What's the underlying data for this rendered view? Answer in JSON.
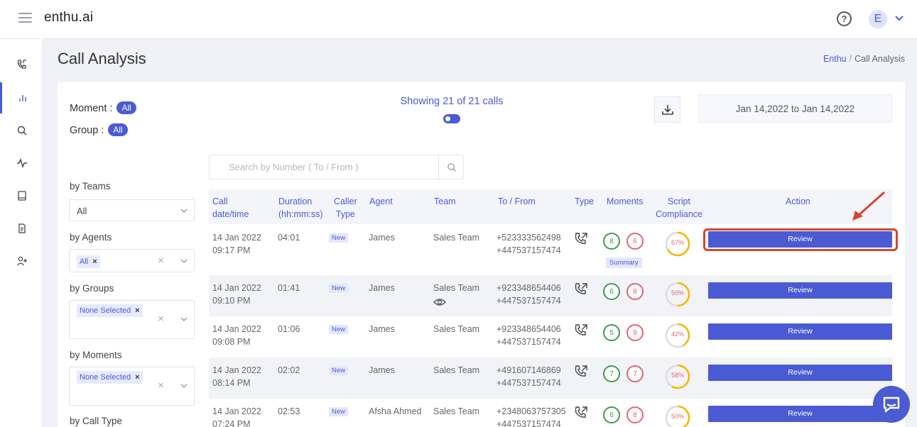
{
  "app": {
    "brand": "enthu.ai",
    "avatar_letter": "E"
  },
  "page": {
    "title": "Call Analysis"
  },
  "breadcrumb": {
    "root": "Enthu",
    "separator": "/",
    "current": "Call Analysis"
  },
  "filters_top": {
    "moment_label": "Moment :",
    "moment_value": "All",
    "group_label": "Group :",
    "group_value": "All"
  },
  "summary": {
    "showing": "Showing 21 of 21 calls"
  },
  "date_range": "Jan 14,2022 to Jan 14,2022",
  "side_filters": {
    "teams": {
      "label": "by Teams",
      "value": "All"
    },
    "agents": {
      "label": "by Agents",
      "chip": "All"
    },
    "groups": {
      "label": "by Groups",
      "chip": "None Selected"
    },
    "moments": {
      "label": "by Moments",
      "chip": "None Selected"
    },
    "call_type": {
      "label": "by Call Type"
    }
  },
  "search": {
    "placeholder": "Search by Number ( To / From )"
  },
  "table": {
    "headers": {
      "call_datetime": [
        "Call",
        "date/time"
      ],
      "duration": [
        "Duration",
        "(hh:mm:ss)"
      ],
      "caller_type": [
        "Caller",
        "Type"
      ],
      "agent": "Agent",
      "team": "Team",
      "to_from": "To / From",
      "type": "Type",
      "moments": "Moments",
      "script": [
        "Script",
        "Compliance"
      ],
      "action": "Action"
    },
    "rows": [
      {
        "date": "14 Jan 2022",
        "time": "09:17 PM",
        "duration": "04:01",
        "caller_type": "New",
        "agent": "James",
        "team": "Sales Team",
        "to": "+523333562498",
        "from": "+447537157474",
        "moments_pos": "8",
        "moments_neg": "6",
        "summary": "Summary",
        "compliance": "67%",
        "compliance_value": 67,
        "action": "Review"
      },
      {
        "date": "14 Jan 2022",
        "time": "09:10 PM",
        "duration": "01:41",
        "caller_type": "New",
        "agent": "James",
        "team": "Sales Team",
        "to": "+923348654406",
        "from": "+447537157474",
        "moments_pos": "6",
        "moments_neg": "8",
        "compliance": "50%",
        "compliance_value": 50,
        "action": "Review"
      },
      {
        "date": "14 Jan 2022",
        "time": "09:08 PM",
        "duration": "01:06",
        "caller_type": "New",
        "agent": "James",
        "team": "Sales Team",
        "to": "+923348654406",
        "from": "+447537157474",
        "moments_pos": "5",
        "moments_neg": "9",
        "compliance": "42%",
        "compliance_value": 42,
        "action": "Review"
      },
      {
        "date": "14 Jan 2022",
        "time": "08:14 PM",
        "duration": "02:02",
        "caller_type": "New",
        "agent": "James",
        "team": "Sales Team",
        "to": "+491607146869",
        "from": "+447537157474",
        "moments_pos": "7",
        "moments_neg": "7",
        "compliance": "58%",
        "compliance_value": 58,
        "action": "Review"
      },
      {
        "date": "14 Jan 2022",
        "time": "07:24 PM",
        "duration": "02:53",
        "caller_type": "New",
        "agent": "Afsha Ahmed",
        "team": "Sales Team",
        "to": "+2348063757305",
        "from": "+447537157474",
        "moments_pos": "6",
        "moments_neg": "8",
        "compliance": "50%",
        "compliance_value": 50,
        "action": "Review"
      }
    ]
  },
  "colors": {
    "accent": "#4a5bd4",
    "positive": "#3f9b4d",
    "negative": "#e56471",
    "compliance_ring": "#f5b800",
    "highlight": "#d6442f"
  },
  "icons": {
    "rail": [
      "phone-icon",
      "bar-chart-icon",
      "search-icon",
      "activity-icon",
      "book-icon",
      "document-icon",
      "add-user-icon"
    ]
  }
}
